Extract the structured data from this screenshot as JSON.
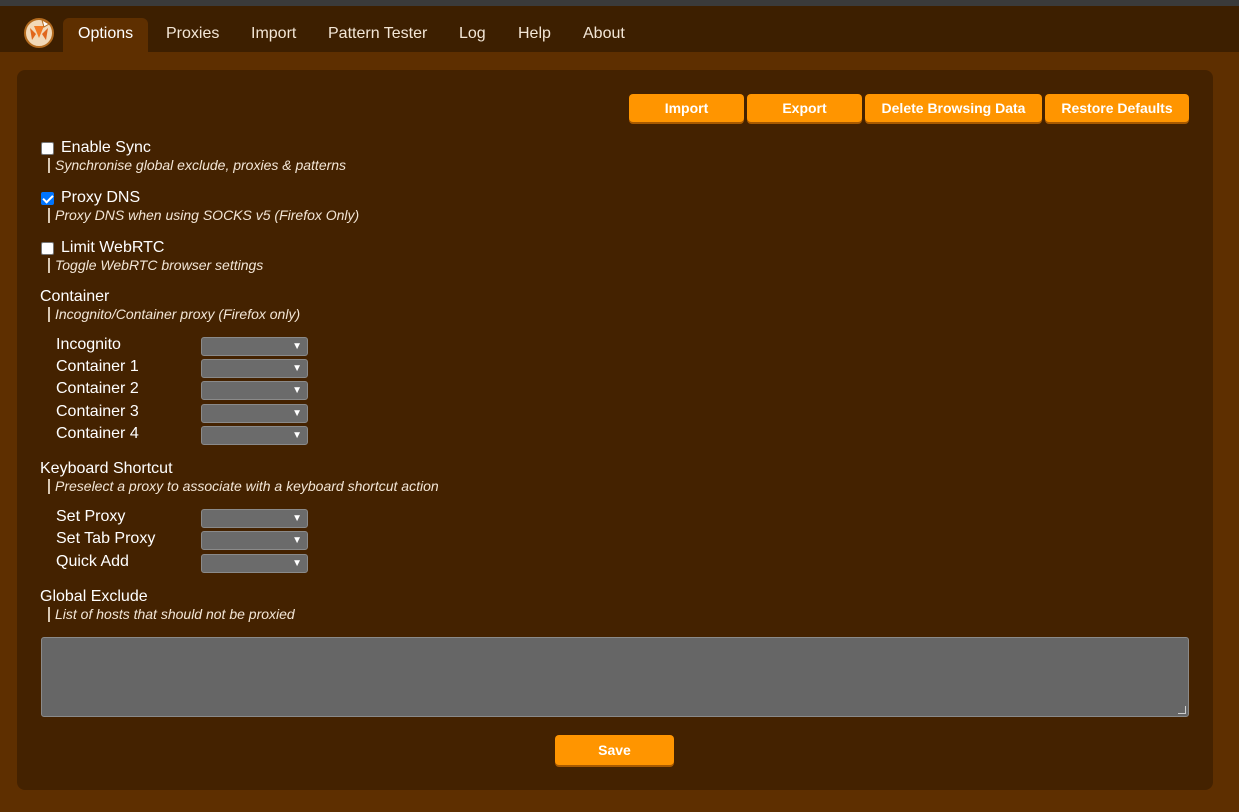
{
  "tabs": [
    {
      "label": "Options"
    },
    {
      "label": "Proxies"
    },
    {
      "label": "Import"
    },
    {
      "label": "Pattern Tester"
    },
    {
      "label": "Log"
    },
    {
      "label": "Help"
    },
    {
      "label": "About"
    }
  ],
  "toolbar": {
    "import_label": "Import",
    "export_label": "Export",
    "delete_label": "Delete Browsing Data",
    "restore_label": "Restore Defaults"
  },
  "options": {
    "sync": {
      "label": "Enable Sync",
      "desc": "Synchronise global exclude, proxies & patterns",
      "checked": false
    },
    "dns": {
      "label": "Proxy DNS",
      "desc": "Proxy DNS when using SOCKS v5 (Firefox Only)",
      "checked": true
    },
    "webrtc": {
      "label": "Limit WebRTC",
      "desc": "Toggle WebRTC browser settings",
      "checked": false
    }
  },
  "container": {
    "heading": "Container",
    "desc": "Incognito/Container proxy (Firefox only)",
    "rows": [
      {
        "label": "Incognito",
        "value": ""
      },
      {
        "label": "Container 1",
        "value": ""
      },
      {
        "label": "Container 2",
        "value": ""
      },
      {
        "label": "Container 3",
        "value": ""
      },
      {
        "label": "Container 4",
        "value": ""
      }
    ]
  },
  "keyboard": {
    "heading": "Keyboard Shortcut",
    "desc": "Preselect a proxy to associate with a keyboard shortcut action",
    "rows": [
      {
        "label": "Set Proxy",
        "value": ""
      },
      {
        "label": "Set Tab Proxy",
        "value": ""
      },
      {
        "label": "Quick Add",
        "value": ""
      }
    ]
  },
  "exclude": {
    "heading": "Global Exclude",
    "desc": "List of hosts that should not be proxied",
    "value": ""
  },
  "save_label": "Save",
  "icons": {
    "logo": "foxyproxy-logo-icon",
    "dropdown": "chevron-down-icon"
  },
  "colors": {
    "accent": "#ff9500",
    "tabbar": "#3d1f00",
    "page": "#5e2f00",
    "panel": "#442200",
    "checkbox_checked": "#0075ff"
  }
}
